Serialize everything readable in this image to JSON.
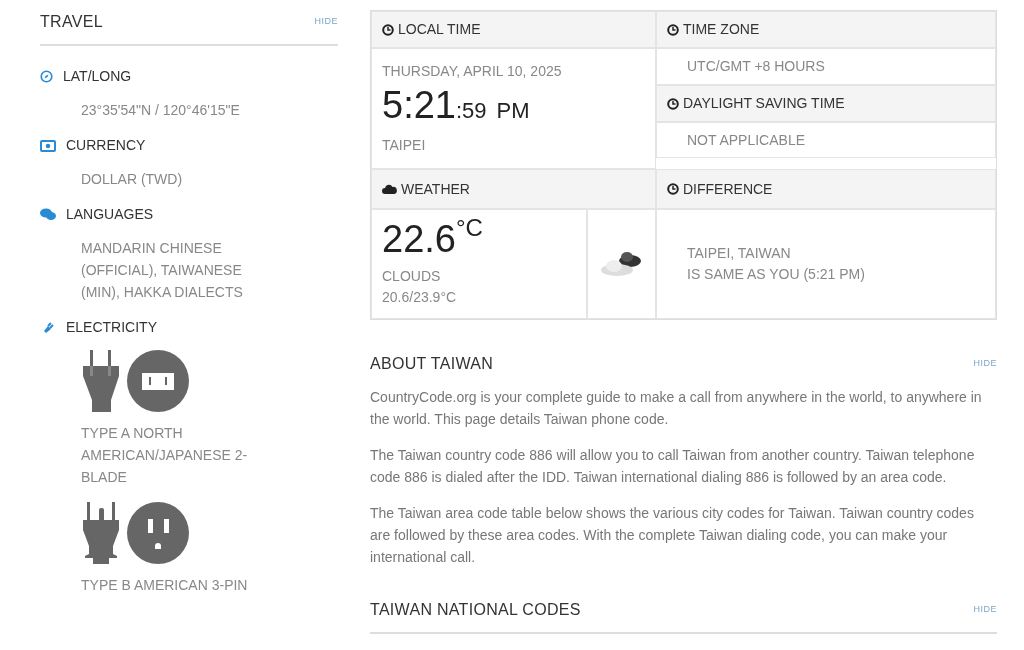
{
  "travel": {
    "title": "TRAVEL",
    "hide": "HIDE",
    "items": [
      {
        "kind": "compass",
        "label": "LAT/LONG",
        "value": "23°35'54\"N / 120°46'15\"E"
      },
      {
        "kind": "money",
        "label": "CURRENCY",
        "value": "DOLLAR (TWD)"
      },
      {
        "kind": "chat",
        "label": "LANGUAGES",
        "value": "MANDARIN CHINESE (OFFICIAL), TAIWANESE (MIN), HAKKA DIALECTS"
      },
      {
        "kind": "plug",
        "label": "ELECTRICITY",
        "plugs": [
          {
            "kind": "type_a",
            "label": "TYPE A NORTH AMERICAN/JAPANESE 2-BLADE"
          },
          {
            "kind": "type_b",
            "label": "TYPE B AMERICAN 3-PIN"
          }
        ]
      }
    ]
  },
  "local_time": {
    "title": "LOCAL TIME",
    "date": "THURSDAY, APRIL 10, 2025",
    "time": "5:21",
    "seconds": ":59",
    "ampm": "PM",
    "city": "TAIPEI"
  },
  "time_zone": {
    "title": "TIME ZONE",
    "value": "UTC/GMT +8 HOURS"
  },
  "daylight_saving": {
    "title": "DAYLIGHT SAVING TIME",
    "value": "NOT APPLICABLE"
  },
  "weather": {
    "title": "WEATHER",
    "temperature": "22.6",
    "unit": "°C",
    "condition": "CLOUDS",
    "range": "20.6/23.9°C"
  },
  "difference": {
    "title": "DIFFERENCE",
    "lines": [
      "TAIPEI, TAIWAN",
      "IS SAME AS YOU (5:21 PM)"
    ]
  },
  "about": {
    "title": "ABOUT TAIWAN",
    "hide": "HIDE",
    "paragraphs": [
      "CountryCode.org is your complete guide to make a call from anywhere in the world, to anywhere in the world. This page details Taiwan phone code.",
      "The Taiwan country code 886 will allow you to call Taiwan from another country. Taiwan telephone code 886 is dialed after the IDD. Taiwan international dialing 886 is followed by an area code.",
      "The Taiwan area code table below shows the various city codes for Taiwan. Taiwan country codes are followed by these area codes. With the complete Taiwan dialing code, you can make your international call."
    ]
  },
  "national_codes": {
    "title": "TAIWAN NATIONAL CODES",
    "hide": "HIDE"
  }
}
